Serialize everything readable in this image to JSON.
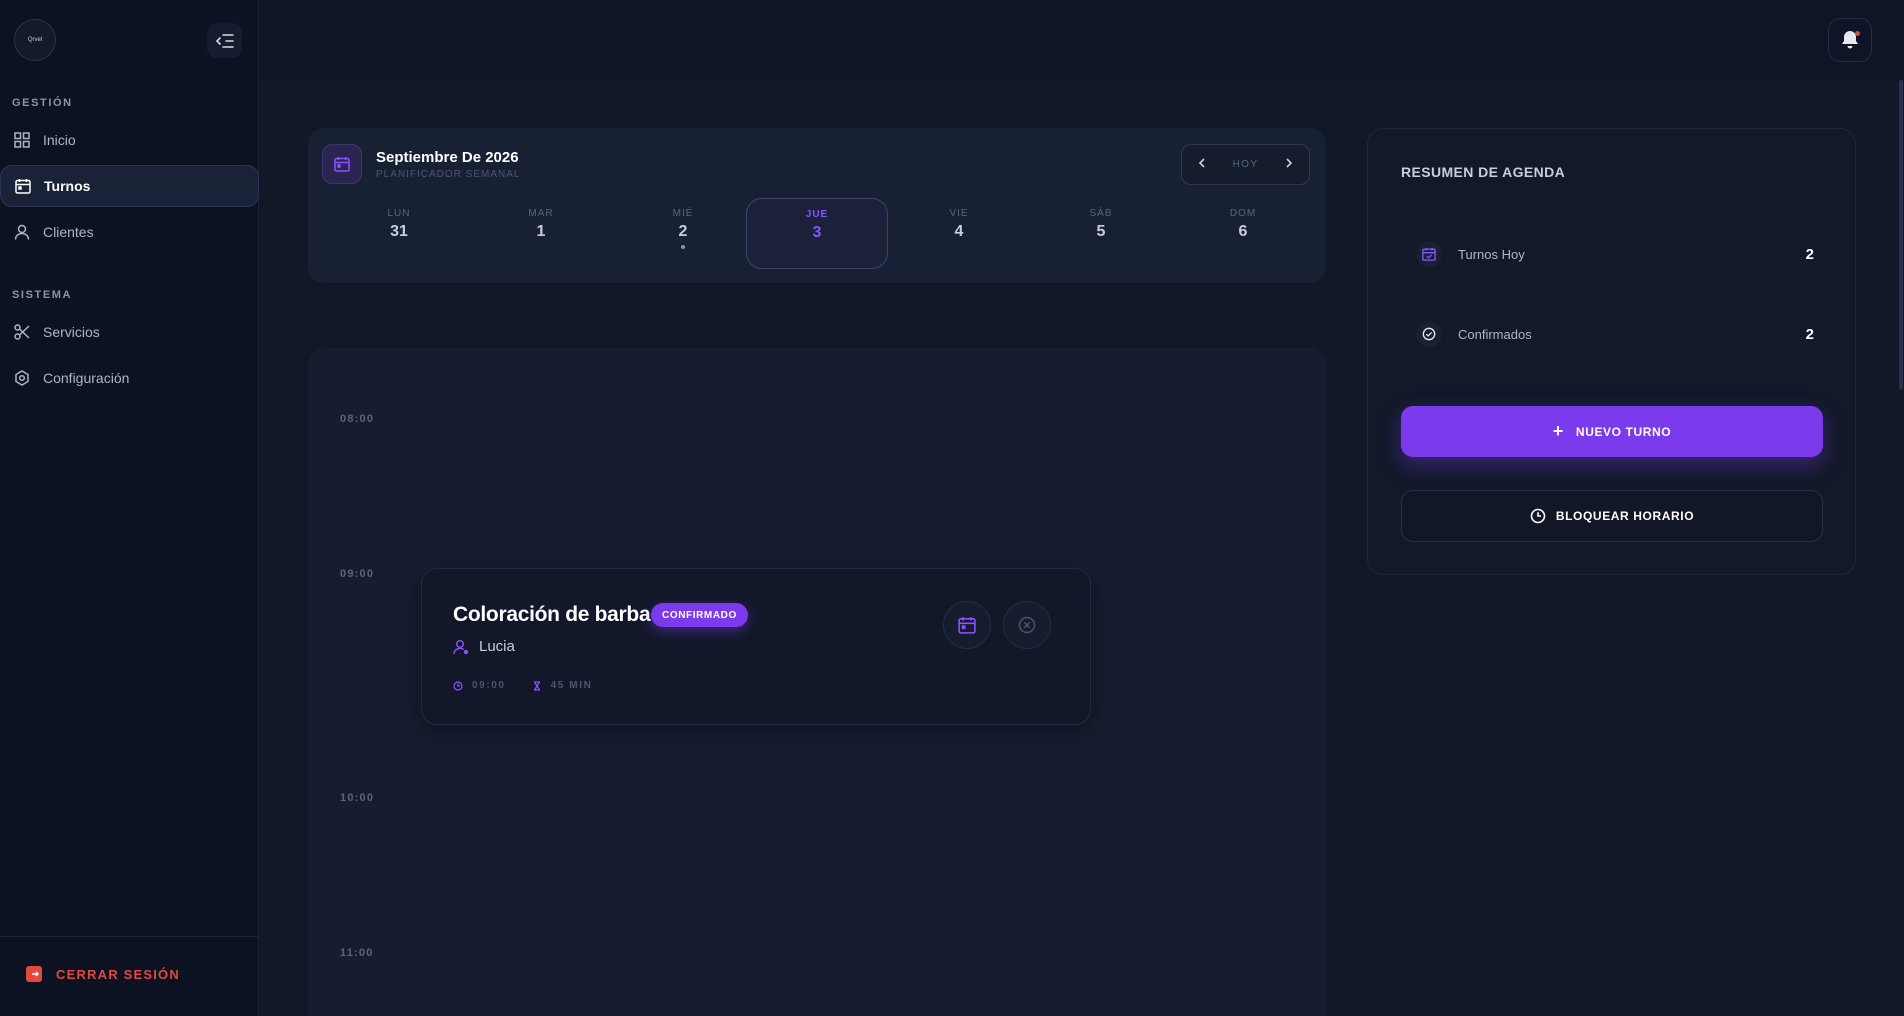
{
  "app": {
    "logo_text": "Qrvel"
  },
  "sidebar": {
    "section_gestion": "GESTIÓN",
    "section_sistema": "SISTEMA",
    "items": [
      {
        "label": "Inicio",
        "icon": "grid-icon"
      },
      {
        "label": "Turnos",
        "icon": "calendar-icon",
        "active": true
      },
      {
        "label": "Clientes",
        "icon": "user-icon"
      },
      {
        "label": "Servicios",
        "icon": "scissors-icon"
      },
      {
        "label": "Configuración",
        "icon": "settings-icon"
      }
    ],
    "logout_label": "CERRAR SESIÓN"
  },
  "calendar": {
    "title": "Septiembre De 2026",
    "subtitle": "PLANIFICADOR SEMANAL",
    "today_label": "HOY",
    "days": [
      {
        "name": "LUN",
        "date": "31"
      },
      {
        "name": "MAR",
        "date": "1"
      },
      {
        "name": "MIÉ",
        "date": "2",
        "has_event": true
      },
      {
        "name": "JUE",
        "date": "3",
        "active": true
      },
      {
        "name": "VIE",
        "date": "4"
      },
      {
        "name": "SÁB",
        "date": "5"
      },
      {
        "name": "DOM",
        "date": "6"
      }
    ]
  },
  "timeline": {
    "hours": [
      "08:00",
      "09:00",
      "10:00",
      "11:00"
    ],
    "appointment": {
      "title": "Coloración de barba",
      "status": "CONFIRMADO",
      "client": "Lucia",
      "time": "09:00",
      "duration": "45 MIN"
    }
  },
  "summary": {
    "title": "RESUMEN DE AGENDA",
    "rows": [
      {
        "label": "Turnos Hoy",
        "value": "2"
      },
      {
        "label": "Confirmados",
        "value": "2"
      }
    ],
    "new_button": "NUEVO TURNO",
    "block_button": "BLOQUEAR HORARIO"
  },
  "colors": {
    "accent": "#7c3aed",
    "danger": "#e5483c",
    "background": "#0f1526"
  }
}
